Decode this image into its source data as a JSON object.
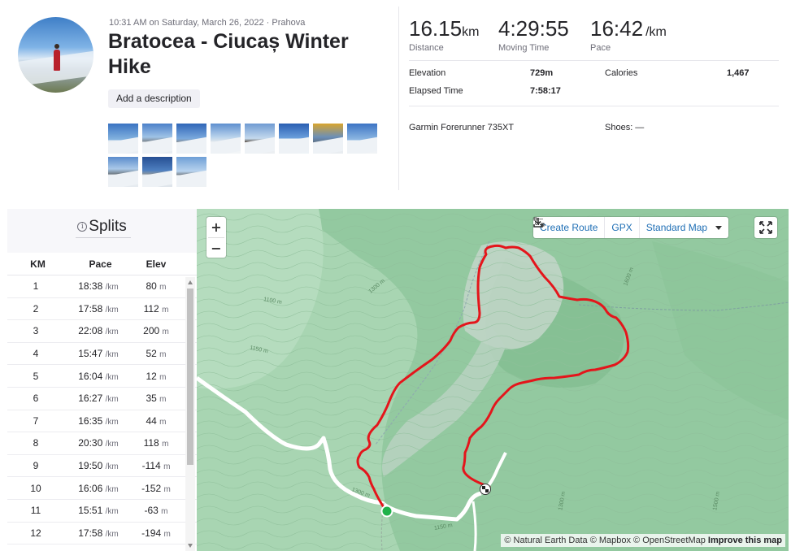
{
  "activity": {
    "meta": "10:31 AM on Saturday, March 26, 2022 · Prahova",
    "title": "Bratocea - Ciucaș Winter Hike",
    "add_description_label": "Add a description",
    "photos_count": 11
  },
  "stats": {
    "distance": {
      "value": "16.15",
      "unit": "km",
      "label": "Distance"
    },
    "moving_time": {
      "value": "4:29:55",
      "label": "Moving Time"
    },
    "pace": {
      "value": "16:42",
      "unit": "/km",
      "label": "Pace"
    },
    "elevation": {
      "label": "Elevation",
      "value": "729m"
    },
    "elapsed_time": {
      "label": "Elapsed Time",
      "value": "7:58:17"
    },
    "calories": {
      "label": "Calories",
      "value": "1,467"
    },
    "device": "Garmin Forerunner 735XT",
    "shoes": "Shoes: —"
  },
  "splits": {
    "title": "Splits",
    "info_icon": "i",
    "headers": {
      "km": "KM",
      "pace": "Pace",
      "elev": "Elev"
    },
    "pace_unit": "/km",
    "elev_unit": "m",
    "rows": [
      {
        "km": "1",
        "pace": "18:38",
        "elev": "80"
      },
      {
        "km": "2",
        "pace": "17:58",
        "elev": "112"
      },
      {
        "km": "3",
        "pace": "22:08",
        "elev": "200"
      },
      {
        "km": "4",
        "pace": "15:47",
        "elev": "52"
      },
      {
        "km": "5",
        "pace": "16:04",
        "elev": "12"
      },
      {
        "km": "6",
        "pace": "16:27",
        "elev": "35"
      },
      {
        "km": "7",
        "pace": "16:35",
        "elev": "44"
      },
      {
        "km": "8",
        "pace": "20:30",
        "elev": "118"
      },
      {
        "km": "9",
        "pace": "19:50",
        "elev": "-114"
      },
      {
        "km": "10",
        "pace": "16:06",
        "elev": "-152"
      },
      {
        "km": "11",
        "pace": "15:51",
        "elev": "-63"
      },
      {
        "km": "12",
        "pace": "17:58",
        "elev": "-194"
      }
    ]
  },
  "map": {
    "zoom_in": "+",
    "zoom_out": "−",
    "create_route": "Create Route",
    "gpx": "GPX",
    "map_style": "Standard Map",
    "attribution": "© Natural Earth Data © Mapbox © OpenStreetMap",
    "improve": "Improve this map",
    "route_color": "#e4151b",
    "start_color": "#1fb24a",
    "contour_labels": [
      "1300 m",
      "1100 m",
      "1150 m",
      "1600 m",
      "1300 m",
      "1150 m",
      "1300 m",
      "1500 m"
    ]
  }
}
